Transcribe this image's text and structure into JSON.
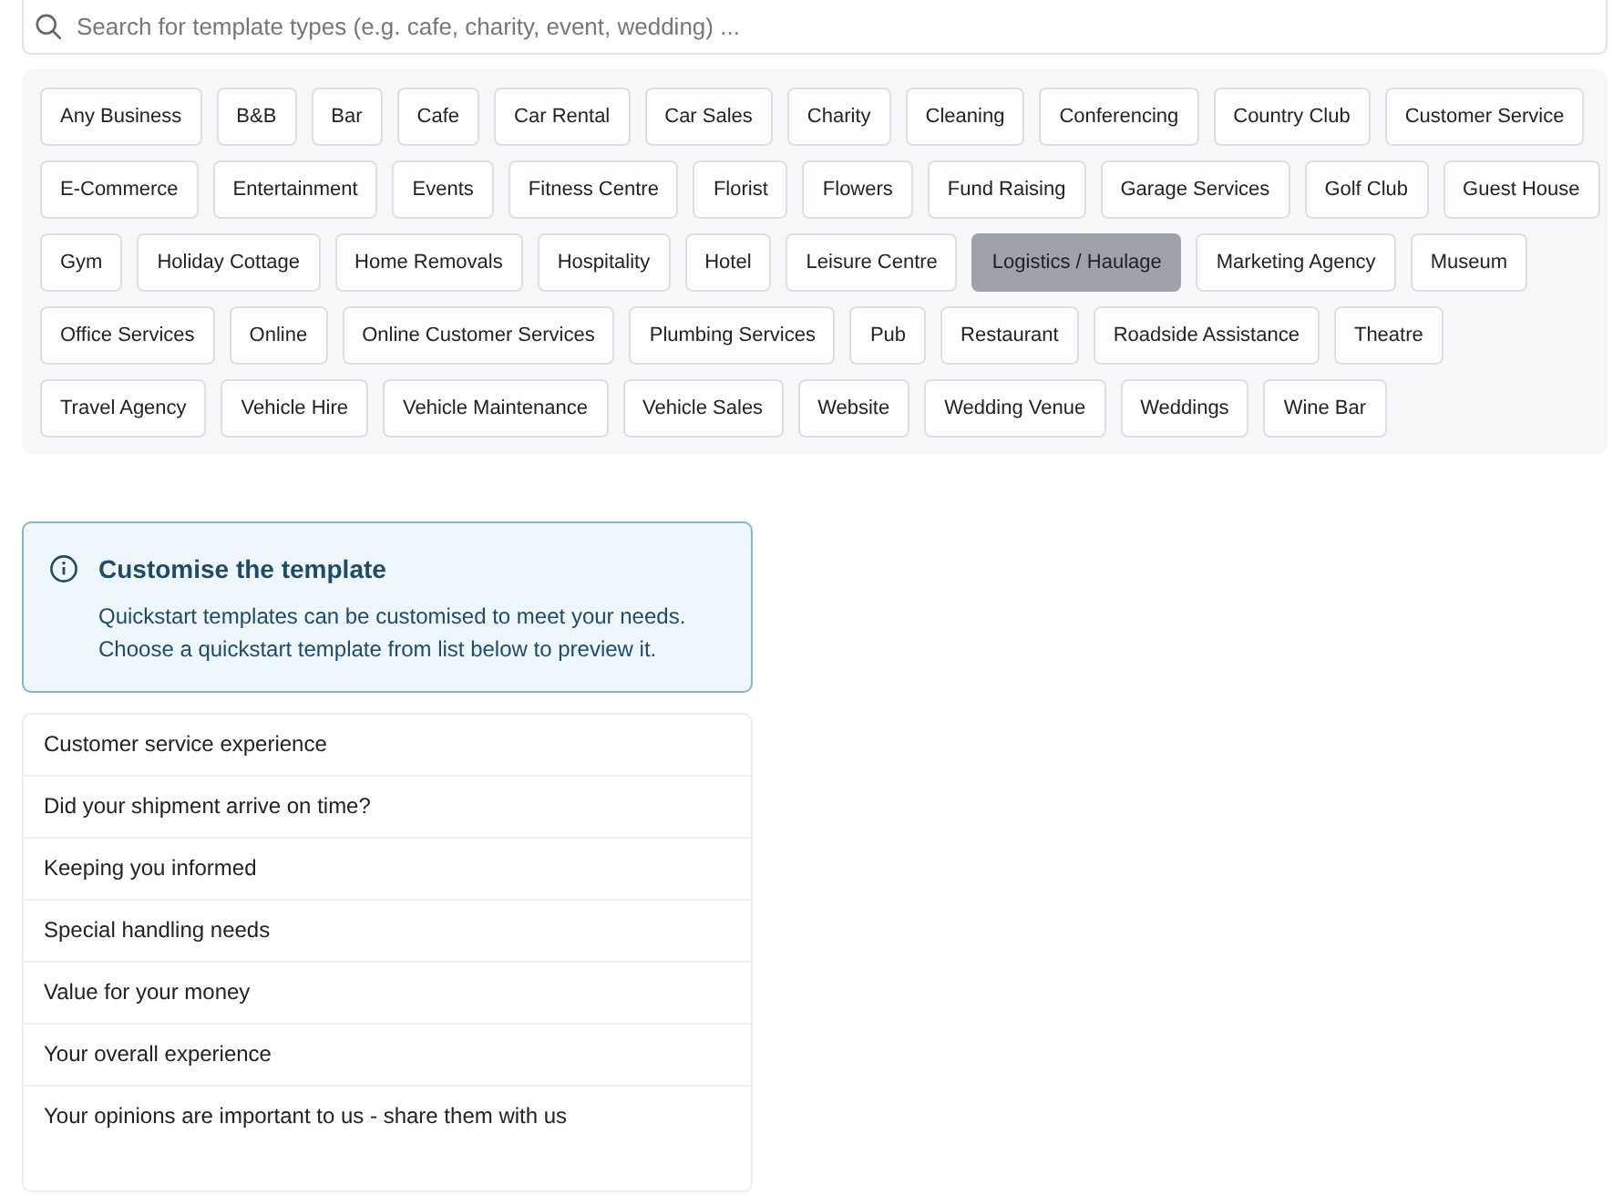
{
  "search": {
    "placeholder": "Search for template types (e.g. cafe, charity, event, wedding) ..."
  },
  "template_types": [
    [
      {
        "label": "Any Business",
        "selected": false
      },
      {
        "label": "B&B",
        "selected": false
      },
      {
        "label": "Bar",
        "selected": false
      },
      {
        "label": "Cafe",
        "selected": false
      },
      {
        "label": "Car Rental",
        "selected": false
      },
      {
        "label": "Car Sales",
        "selected": false
      },
      {
        "label": "Charity",
        "selected": false
      },
      {
        "label": "Cleaning",
        "selected": false
      },
      {
        "label": "Conferencing",
        "selected": false
      },
      {
        "label": "Country Club",
        "selected": false
      },
      {
        "label": "Customer Service",
        "selected": false
      }
    ],
    [
      {
        "label": "E-Commerce",
        "selected": false
      },
      {
        "label": "Entertainment",
        "selected": false
      },
      {
        "label": "Events",
        "selected": false
      },
      {
        "label": "Fitness Centre",
        "selected": false
      },
      {
        "label": "Florist",
        "selected": false
      },
      {
        "label": "Flowers",
        "selected": false
      },
      {
        "label": "Fund Raising",
        "selected": false
      },
      {
        "label": "Garage Services",
        "selected": false
      },
      {
        "label": "Golf Club",
        "selected": false
      },
      {
        "label": "Guest House",
        "selected": false
      }
    ],
    [
      {
        "label": "Gym",
        "selected": false
      },
      {
        "label": "Holiday Cottage",
        "selected": false
      },
      {
        "label": "Home Removals",
        "selected": false
      },
      {
        "label": "Hospitality",
        "selected": false
      },
      {
        "label": "Hotel",
        "selected": false
      },
      {
        "label": "Leisure Centre",
        "selected": false
      },
      {
        "label": "Logistics / Haulage",
        "selected": true
      },
      {
        "label": "Marketing Agency",
        "selected": false
      },
      {
        "label": "Museum",
        "selected": false
      }
    ],
    [
      {
        "label": "Office Services",
        "selected": false
      },
      {
        "label": "Online",
        "selected": false
      },
      {
        "label": "Online Customer Services",
        "selected": false
      },
      {
        "label": "Plumbing Services",
        "selected": false
      },
      {
        "label": "Pub",
        "selected": false
      },
      {
        "label": "Restaurant",
        "selected": false
      },
      {
        "label": "Roadside Assistance",
        "selected": false
      },
      {
        "label": "Theatre",
        "selected": false
      }
    ],
    [
      {
        "label": "Travel Agency",
        "selected": false
      },
      {
        "label": "Vehicle Hire",
        "selected": false
      },
      {
        "label": "Vehicle Maintenance",
        "selected": false
      },
      {
        "label": "Vehicle Sales",
        "selected": false
      },
      {
        "label": "Website",
        "selected": false
      },
      {
        "label": "Wedding Venue",
        "selected": false
      },
      {
        "label": "Weddings",
        "selected": false
      },
      {
        "label": "Wine Bar",
        "selected": false
      }
    ]
  ],
  "info": {
    "title": "Customise the template",
    "lines": [
      "Quickstart templates can be customised to meet your needs.",
      "Choose a quickstart template from list below to preview it."
    ]
  },
  "templates": [
    "Customer service experience",
    "Did your shipment arrive on time?",
    "Keeping you informed",
    "Special handling needs",
    "Value for your money",
    "Your overall experience",
    "Your opinions are important to us - share them with us"
  ]
}
